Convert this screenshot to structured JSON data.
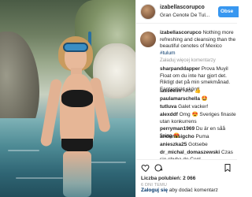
{
  "post": {
    "username": "izabellascorupco",
    "location": "Gran Cenote De Tul...",
    "follow_label": "Obse"
  },
  "caption": {
    "username": "izabellascorupco",
    "text": "Nothing more refreshing and cleansing than the beautiful cenotes of Mexico",
    "hashtag": "#tulum",
    "more_label": "Załaduj więcej komentarzy"
  },
  "comments": [
    {
      "user": "sharpanddapper",
      "text": "Prova Muyil Float om du inte har gjort det. Riktigt det på min smekmånad. Fantastiskt skönt!"
    },
    {
      "user": "lasseelm",
      "text": "Nice 👍"
    },
    {
      "user": "paulamarschella",
      "text": "🤩"
    },
    {
      "user": "tutluva",
      "text": "Galet vacker!"
    },
    {
      "user": "alexddf",
      "text": "Omg 😍 Sveriges finaste utan konkurrens"
    },
    {
      "user": "perryman1969",
      "text": "Du är en såå fining 😍"
    },
    {
      "user": "andenssigcho",
      "text": "Puma"
    },
    {
      "user": "anieszka25",
      "text": "Gotsebe"
    },
    {
      "user": "dr_michal_domaszewski",
      "text": "Czas się chyba do Cenl..."
    }
  ],
  "actions": {
    "likes": "Liczba polubień: 2 066",
    "date": "6 DNI TEMU"
  },
  "login": {
    "link": "Zaloguj się",
    "text": "aby dodać komentarz"
  }
}
